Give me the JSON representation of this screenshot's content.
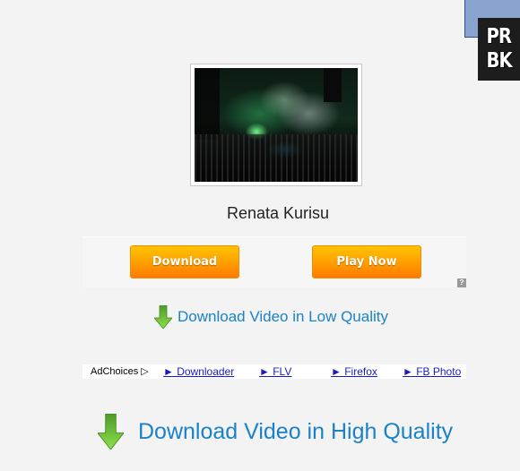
{
  "corner_logo": {
    "line1": "PR",
    "line2": "BK"
  },
  "video": {
    "thumbnail_alt": "concert-thumbnail",
    "artist": "Renata Kurisu"
  },
  "ad_unit": {
    "buttons": [
      {
        "label": "Download"
      },
      {
        "label": "Play Now"
      }
    ],
    "info_icon": "?"
  },
  "download_low": {
    "label": "Download Video in Low Quality",
    "icon": "green-down-arrow"
  },
  "ad_links_bar": {
    "adchoices_label": "AdChoices",
    "adchoices_icon": "▷",
    "links": [
      {
        "label": "► Downloader"
      },
      {
        "label": "► FLV"
      },
      {
        "label": "► Firefox"
      },
      {
        "label": "► FB Photo"
      }
    ]
  },
  "download_high": {
    "label": "Download Video in High Quality",
    "icon": "green-down-arrow"
  },
  "colors": {
    "link_blue": "#1a82c8",
    "button_orange": "#ff9000",
    "arrow_green": "#6cc33a",
    "background": "#f3f3f3"
  }
}
